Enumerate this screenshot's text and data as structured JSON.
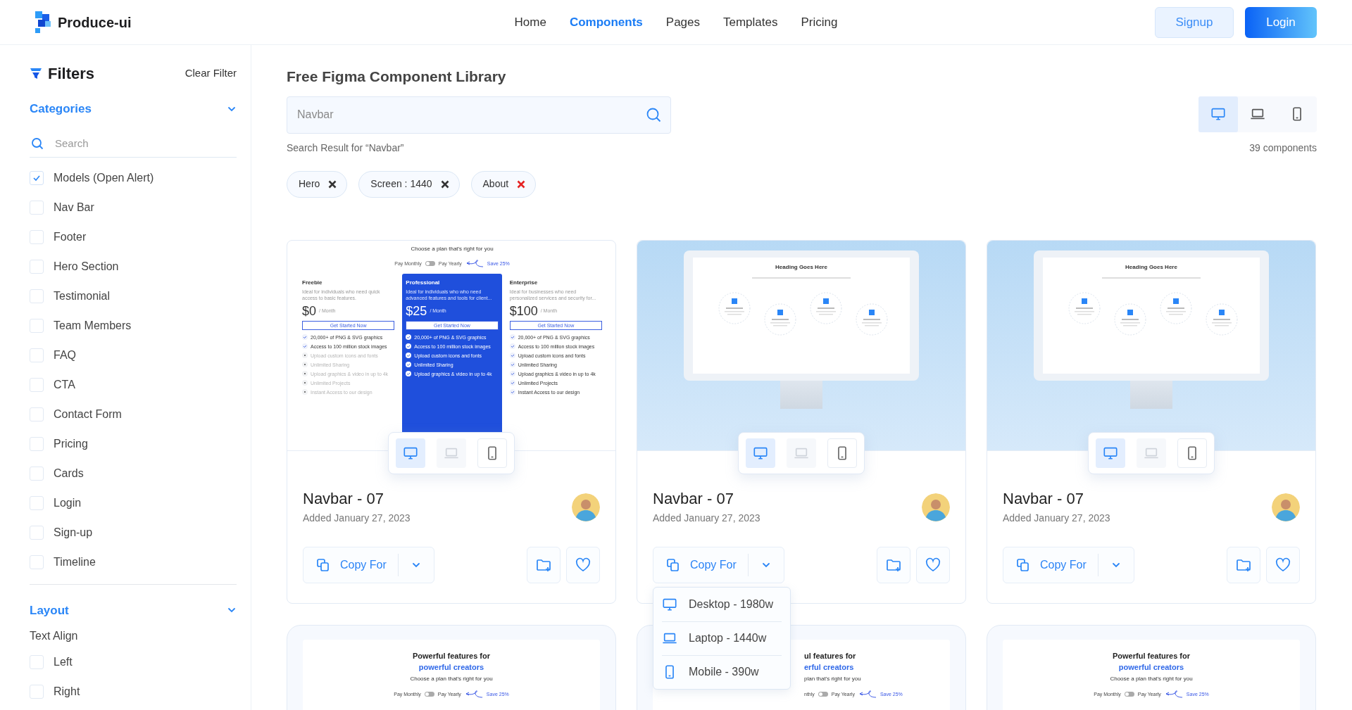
{
  "header": {
    "brand": "Produce-ui",
    "nav": [
      {
        "label": "Home",
        "selected": false
      },
      {
        "label": "Components",
        "selected": true
      },
      {
        "label": "Pages",
        "selected": false
      },
      {
        "label": "Templates",
        "selected": false
      },
      {
        "label": "Pricing",
        "selected": false
      }
    ],
    "buttons": [
      {
        "label": "Signup",
        "kind": "secondary"
      },
      {
        "label": "Login",
        "kind": "primary"
      }
    ]
  },
  "sidebar": {
    "title": "Filters",
    "clear": "Clear Filter",
    "categories": {
      "title": "Categories",
      "expanded": true,
      "search": {
        "placeholder": "Search"
      },
      "items": [
        {
          "label": "Models (Open Alert)",
          "checked": true
        },
        {
          "label": "Nav Bar",
          "checked": false
        },
        {
          "label": "Footer",
          "checked": false
        },
        {
          "label": "Hero Section",
          "checked": false
        },
        {
          "label": "Testimonial",
          "checked": false
        },
        {
          "label": "Team Members",
          "checked": false
        },
        {
          "label": "FAQ",
          "checked": false
        },
        {
          "label": "CTA",
          "checked": false
        },
        {
          "label": "Contact Form",
          "checked": false
        },
        {
          "label": "Pricing",
          "checked": false
        },
        {
          "label": "Cards",
          "checked": false
        },
        {
          "label": "Login",
          "checked": false
        },
        {
          "label": "Sign-up",
          "checked": false
        },
        {
          "label": "Timeline",
          "checked": false
        }
      ]
    },
    "layout": {
      "title": "Layout",
      "expanded": true,
      "subheading": "Text Align",
      "items": [
        {
          "label": "Left",
          "checked": false
        },
        {
          "label": "Right",
          "checked": false
        }
      ]
    }
  },
  "main": {
    "title": "Free Figma Component Library",
    "search": {
      "value": "Navbar"
    },
    "views": [
      {
        "kind": "desktop",
        "selected": true
      },
      {
        "kind": "laptop",
        "selected": false
      },
      {
        "kind": "mobile",
        "selected": false
      }
    ],
    "result_text": "Search Result for “Navbar”",
    "count": "39 components",
    "chips": [
      {
        "label": "Hero",
        "color": "#333333"
      },
      {
        "label": "Screen : 1440",
        "color": "#333333"
      },
      {
        "label": "About",
        "color": "#e52222"
      }
    ],
    "cards": [
      {
        "title": "Navbar - 07",
        "date": "Added January 27, 2023",
        "copy_label": "Copy For",
        "devices": [
          {
            "kind": "desktop",
            "selected": true,
            "disabled": false
          },
          {
            "kind": "laptop",
            "selected": false,
            "disabled": true
          },
          {
            "kind": "mobile",
            "selected": false,
            "disabled": false
          }
        ],
        "preview": {
          "kind": "pricing",
          "title": "Choose a plan that's right for you",
          "toggle_left": "Pay Monthly",
          "toggle_on": false,
          "toggle_right": "Pay Yearly",
          "save": "Save 25%",
          "plans": [
            {
              "name": "Freebie",
              "desc": "Ideal for individuals who need quick access to basic features.",
              "price": "$0",
              "per": "/ Month",
              "button": "Get Started Now",
              "selected": false,
              "features": [
                {
                  "text": "20,000+ of PNG & SVG graphics",
                  "included": true
                },
                {
                  "text": "Access to 100 million stock images",
                  "included": true
                },
                {
                  "text": "Upload custom icons and fonts",
                  "included": false
                },
                {
                  "text": "Unlimited Sharing",
                  "included": false
                },
                {
                  "text": "Upload graphics & video in up to 4k",
                  "included": false
                },
                {
                  "text": "Unlimited Projects",
                  "included": false
                },
                {
                  "text": "Instant Access to our design",
                  "included": false
                }
              ]
            },
            {
              "name": "Professional",
              "desc": "Ideal for individuals who who need advanced features and tools for client...",
              "price": "$25",
              "per": "/ Month",
              "button": "Get Started Now",
              "selected": true,
              "features": [
                {
                  "text": "20,000+ of PNG & SVG graphics",
                  "included": true
                },
                {
                  "text": "Access to 100 million stock images",
                  "included": true
                },
                {
                  "text": "Upload custom icons and fonts",
                  "included": true
                },
                {
                  "text": "Unlimited Sharing",
                  "included": true
                },
                {
                  "text": "Upload graphics & video in up to 4k",
                  "included": true
                }
              ]
            },
            {
              "name": "Enterprise",
              "desc": "Ideal for businesses who need personalized services and security for...",
              "price": "$100",
              "per": "/ Month",
              "button": "Get Started Now",
              "selected": false,
              "features": [
                {
                  "text": "20,000+ of PNG & SVG graphics",
                  "included": true
                },
                {
                  "text": "Access to 100 million stock images",
                  "included": true
                },
                {
                  "text": "Upload custom icons and fonts",
                  "included": true
                },
                {
                  "text": "Unlimited Sharing",
                  "included": true
                },
                {
                  "text": "Upload graphics & video in up to 4k",
                  "included": true
                },
                {
                  "text": "Unlimited Projects",
                  "included": true
                },
                {
                  "text": "Instant Access to our design",
                  "included": true
                }
              ]
            }
          ]
        }
      },
      {
        "title": "Navbar - 07",
        "date": "Added January 27, 2023",
        "copy_label": "Copy For",
        "devices": [
          {
            "kind": "desktop",
            "selected": true,
            "disabled": false
          },
          {
            "kind": "laptop",
            "selected": false,
            "disabled": true
          },
          {
            "kind": "mobile",
            "selected": false,
            "disabled": false
          }
        ],
        "preview": {
          "kind": "monitor",
          "heading": "Heading Goes Here"
        },
        "menu": [
          {
            "kind": "desktop",
            "label": "Desktop - 1980w"
          },
          {
            "kind": "laptop",
            "label": "Laptop - 1440w"
          },
          {
            "kind": "mobile",
            "label": "Mobile - 390w"
          }
        ]
      },
      {
        "title": "Navbar - 07",
        "date": "Added January 27, 2023",
        "copy_label": "Copy For",
        "devices": [
          {
            "kind": "desktop",
            "selected": true,
            "disabled": false
          },
          {
            "kind": "laptop",
            "selected": false,
            "disabled": true
          },
          {
            "kind": "mobile",
            "selected": false,
            "disabled": false
          }
        ],
        "preview": {
          "kind": "monitor",
          "heading": "Heading Goes Here"
        }
      },
      {
        "preview": {
          "kind": "features",
          "covered": false,
          "heading": "Powerful features for",
          "accent": "powerful creators",
          "sub": "Choose a plan that's right for you",
          "toggle_left": "Pay Monthly",
          "toggle_on": false,
          "toggle_right": "Pay Yearly",
          "save": "Save 25%"
        }
      },
      {
        "preview": {
          "kind": "features",
          "covered": true,
          "heading": "ul features for",
          "accent": "erful creators",
          "sub": "plan that's right for you",
          "toggle_left": "nthly",
          "toggle_on": false,
          "toggle_right": "Pay Yearly",
          "save": "Save 25%"
        }
      },
      {
        "preview": {
          "kind": "features",
          "covered": false,
          "heading": "Powerful features for",
          "accent": "powerful creators",
          "sub": "Choose a plan that's right for you",
          "toggle_left": "Pay Monthly",
          "toggle_on": false,
          "toggle_right": "Pay Yearly",
          "save": "Save 25%"
        }
      }
    ]
  }
}
